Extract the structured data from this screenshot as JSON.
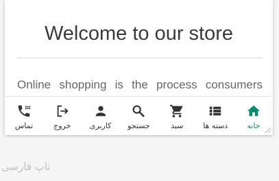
{
  "page": {
    "title": "Welcome to our store",
    "paragraph": "Online shopping is the process consumers go"
  },
  "nav": {
    "items": [
      {
        "label": "خانه",
        "icon": "home-icon",
        "active": true
      },
      {
        "label": "دسته ها",
        "icon": "categories-icon",
        "active": false
      },
      {
        "label": "سبد",
        "icon": "cart-icon",
        "active": false
      },
      {
        "label": "جستجو",
        "icon": "search-icon",
        "active": false
      },
      {
        "label": "کاربری",
        "icon": "user-icon",
        "active": false
      },
      {
        "label": "خروج",
        "icon": "logout-icon",
        "active": false
      },
      {
        "label": "تماس",
        "icon": "phone-icon",
        "active": false
      }
    ]
  },
  "footer": {
    "brand": "ناپ فارسی"
  },
  "colors": {
    "accent": "#0c8b6d",
    "icon": "#333333"
  }
}
